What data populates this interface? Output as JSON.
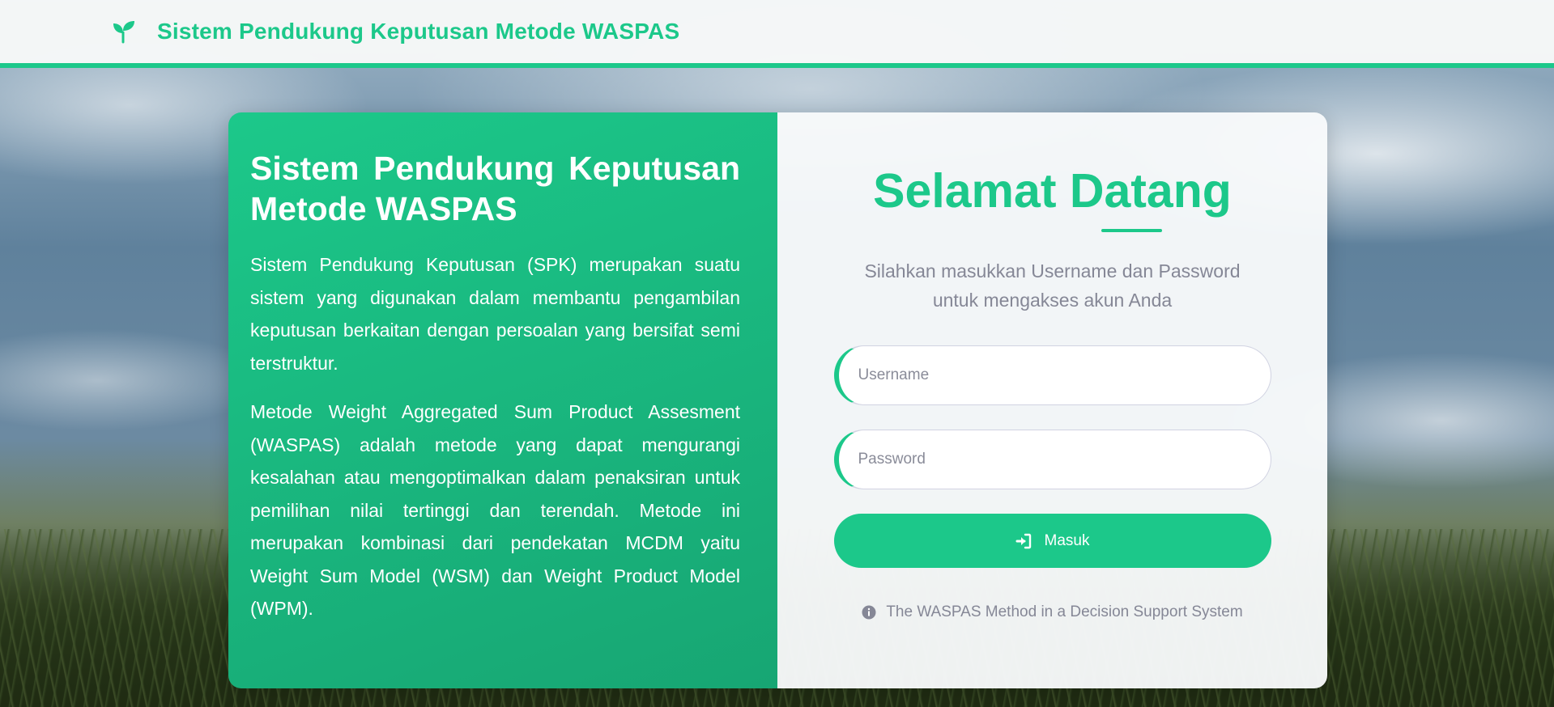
{
  "navbar": {
    "brand_icon": "seedling-icon",
    "title": "Sistem Pendukung Keputusan Metode WASPAS"
  },
  "intro": {
    "title": "Sistem Pendukung Keputusan Metode WASPAS",
    "paragraph1": "Sistem Pendukung Keputusan (SPK) merupakan suatu sistem yang digunakan dalam membantu pengambilan keputusan berkaitan dengan persoalan yang bersifat semi terstruktur.",
    "paragraph2": "Metode Weight Aggregated Sum Product Assesment (WASPAS) adalah metode yang dapat mengurangi kesalahan atau mengoptimalkan dalam penaksiran untuk pemilihan nilai tertinggi dan terendah. Metode ini merupakan kombinasi dari pendekatan MCDM yaitu Weight Sum Model (WSM) dan Weight Product Model (WPM)."
  },
  "login": {
    "heading": "Selamat Datang",
    "subtitle": "Silahkan masukkan Username dan Password untuk mengakses akun Anda",
    "username_placeholder": "Username",
    "password_placeholder": "Password",
    "submit_label": "Masuk",
    "submit_icon": "sign-in-icon",
    "note_icon": "info-circle-icon",
    "note": "The WASPAS Method in a Decision Support System"
  },
  "colors": {
    "accent": "#1cc88a",
    "accent_dark": "#17a673",
    "muted_text": "#858796"
  }
}
